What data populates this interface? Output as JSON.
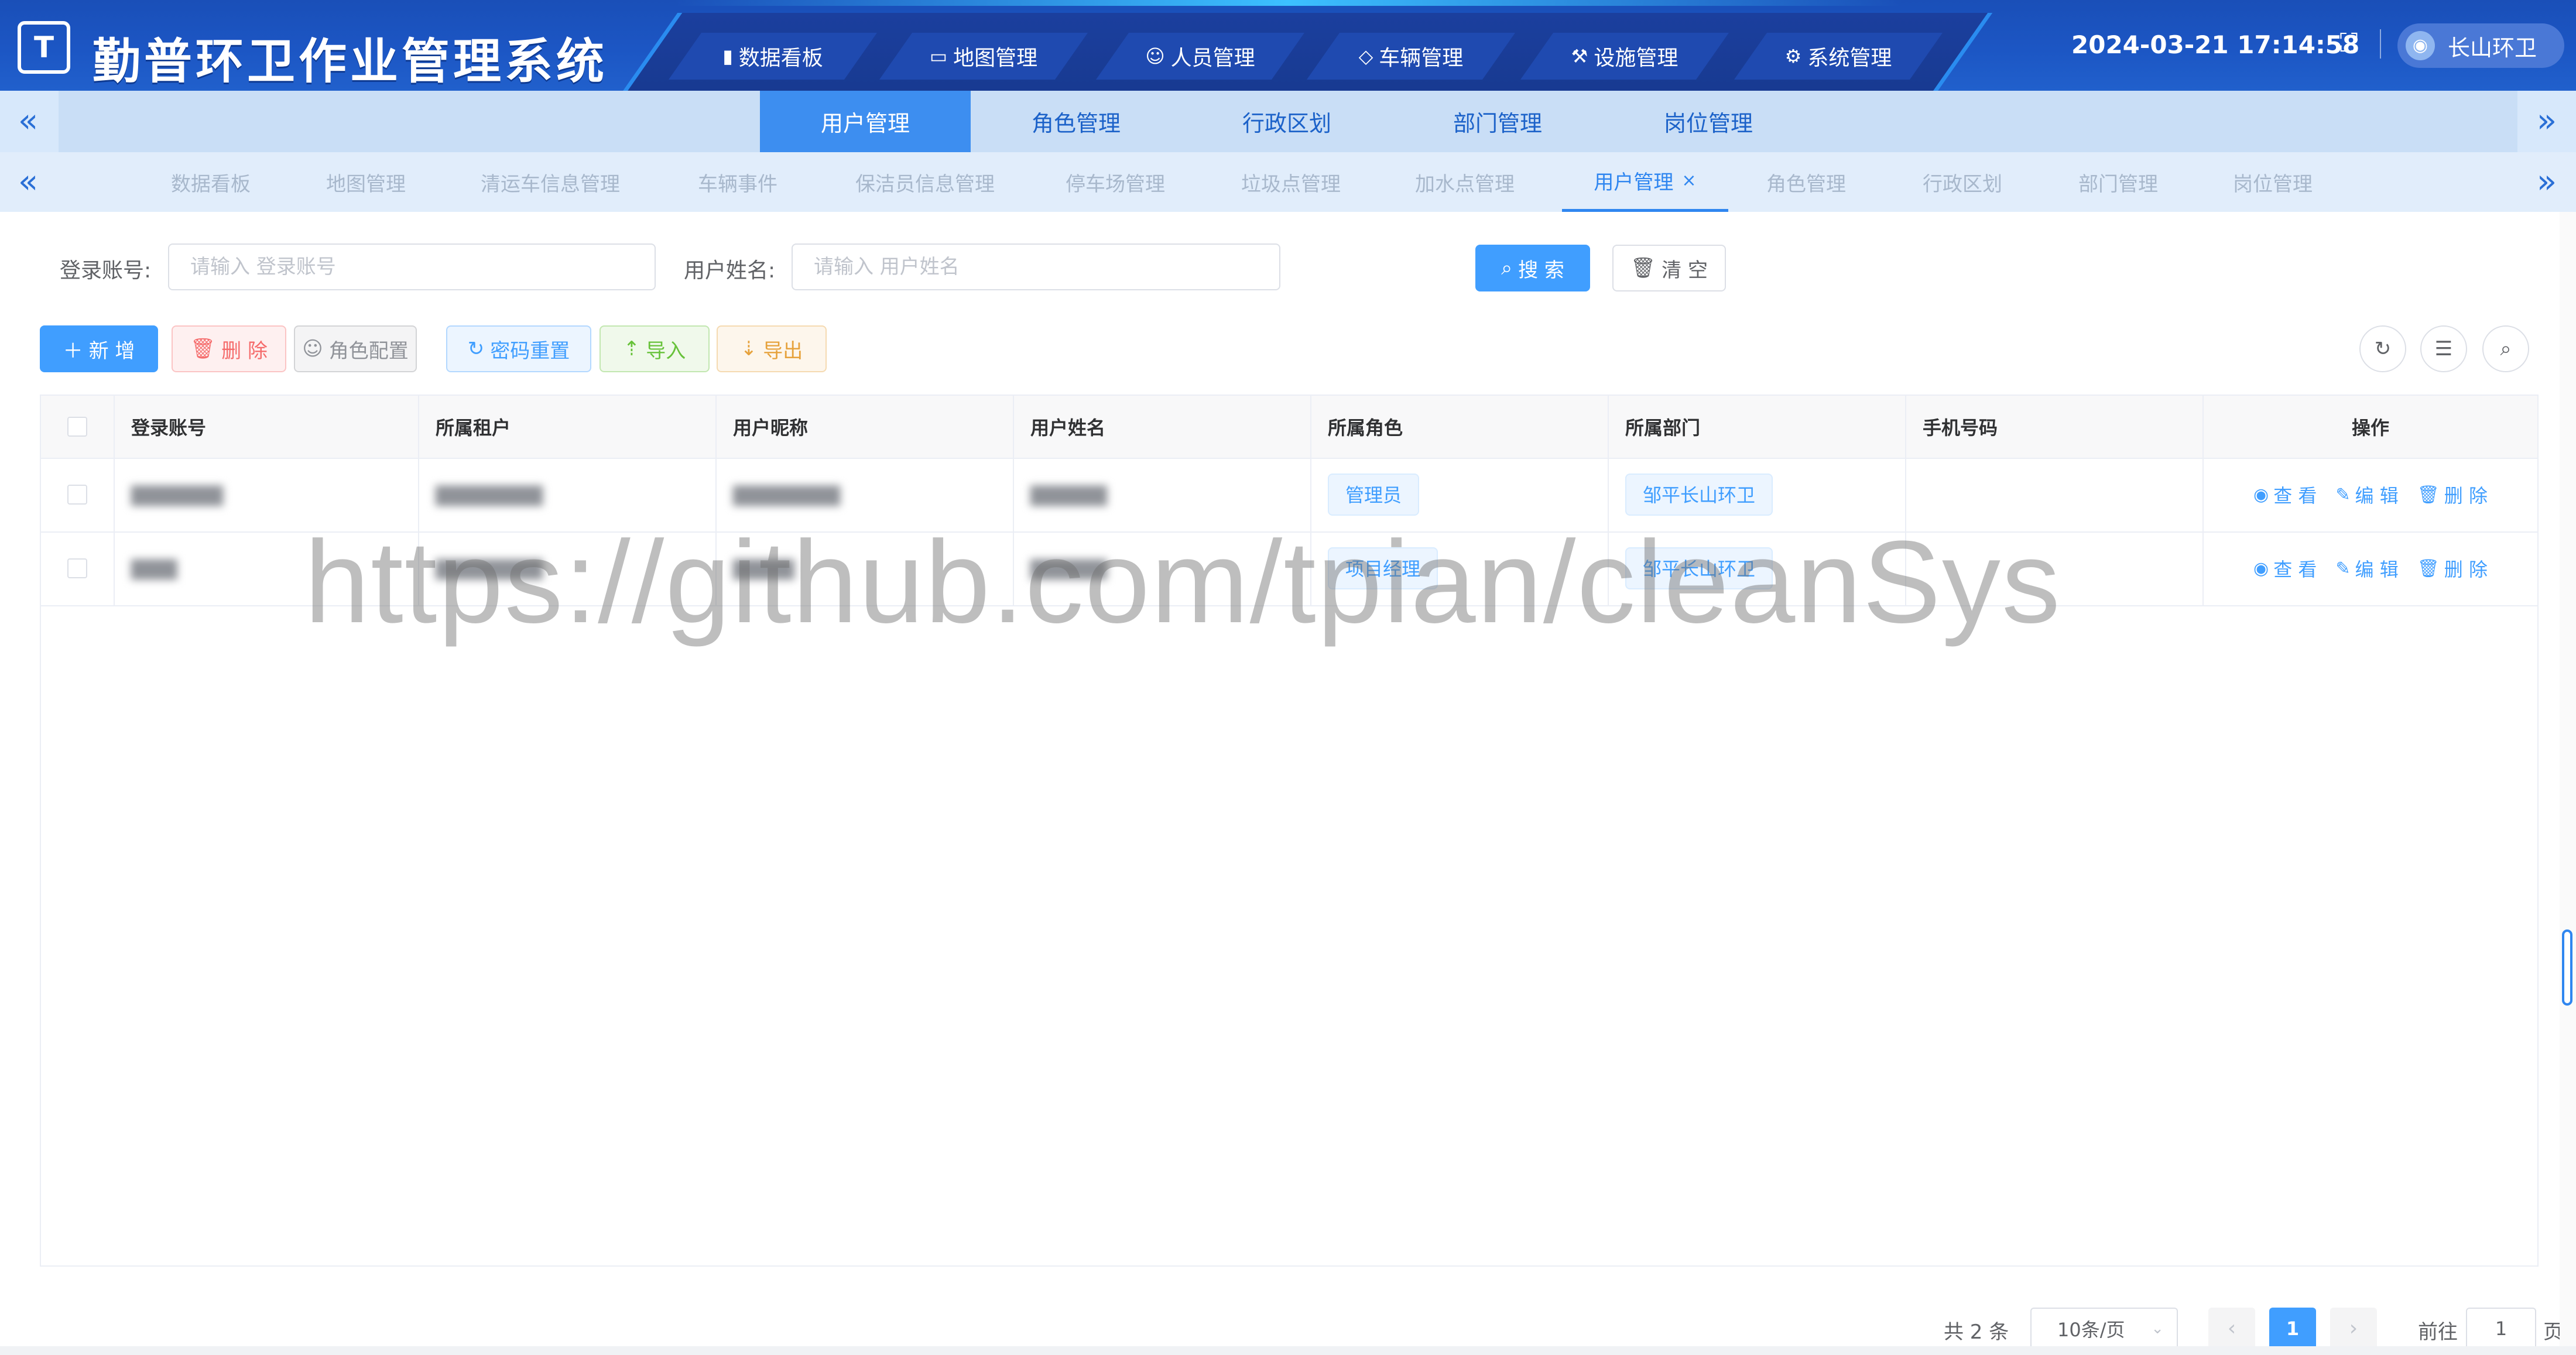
{
  "header": {
    "logo_glyph": "T",
    "title": "勤普环卫作业管理系统",
    "nav": [
      {
        "icon": "bar-chart-icon",
        "glyph": "▮",
        "label": "数据看板"
      },
      {
        "icon": "monitor-icon",
        "glyph": "▭",
        "label": "地图管理"
      },
      {
        "icon": "person-icon",
        "glyph": "☺",
        "label": "人员管理"
      },
      {
        "icon": "shield-icon",
        "glyph": "◇",
        "label": "车辆管理"
      },
      {
        "icon": "wrench-icon",
        "glyph": "⚒",
        "label": "设施管理"
      },
      {
        "icon": "gear-icon",
        "glyph": "⚙",
        "label": "系统管理"
      }
    ],
    "datetime": "2024-03-21 17:14:58",
    "user_name": "长山环卫"
  },
  "menu": {
    "items": [
      "用户管理",
      "角色管理",
      "行政区划",
      "部门管理",
      "岗位管理"
    ],
    "active_index": 0
  },
  "tags": {
    "items": [
      "数据看板",
      "地图管理",
      "清运车信息管理",
      "车辆事件",
      "保洁员信息管理",
      "停车场管理",
      "垃圾点管理",
      "加水点管理",
      "用户管理",
      "角色管理",
      "行政区划",
      "部门管理",
      "岗位管理"
    ],
    "active_index": 8
  },
  "search": {
    "account_label": "登录账号:",
    "account_placeholder": "请输入 登录账号",
    "username_label": "用户姓名:",
    "username_placeholder": "请输入 用户姓名",
    "search_button": "搜 索",
    "clear_button": "清 空"
  },
  "toolbar": {
    "add": "新 增",
    "delete": "删 除",
    "role_config": "角色配置",
    "reset_password": "密码重置",
    "import": "导入",
    "export": "导出"
  },
  "table": {
    "columns": [
      "登录账号",
      "所属租户",
      "用户昵称",
      "用户姓名",
      "所属角色",
      "所属部门",
      "手机号码",
      "操作"
    ],
    "rows": [
      {
        "account": "▇▇▇▇▇▇",
        "tenant": "▇▇▇▇▇▇▇",
        "nickname": "▇▇▇▇▇▇▇",
        "name": "▇▇▇▇▇",
        "role": "管理员",
        "dept": "邹平长山环卫",
        "phone": ""
      },
      {
        "account": "▇▇▇",
        "tenant": "▇▇▇▇▇▇▇",
        "nickname": "▇▇▇▇",
        "name": "▇▇▇▇▇",
        "role": "项目经理",
        "dept": "邹平长山环卫",
        "phone": ""
      }
    ],
    "actions": {
      "view": "查 看",
      "edit": "编 辑",
      "delete": "删 除"
    }
  },
  "watermark": "https://github.com/tpian/cleanSys",
  "pagination": {
    "total": "共 2 条",
    "page_size": "10条/页",
    "current_page": "1",
    "goto_label": "前往",
    "goto_value": "1",
    "page_suffix": "页"
  },
  "colors": {
    "primary": "#409eff",
    "header_bg": "#1c56c4",
    "menu_active": "#3d8ef0",
    "danger": "#f56c6c",
    "success": "#67c23a",
    "warning": "#e6a23c"
  }
}
